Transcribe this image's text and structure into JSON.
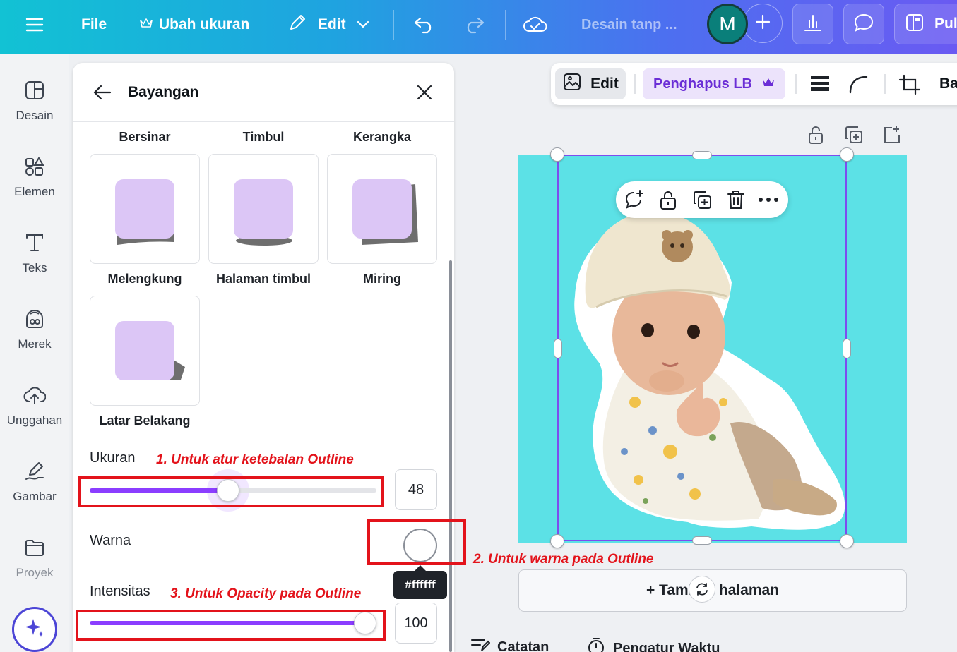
{
  "topbar": {
    "file_label": "File",
    "resize_label": "Ubah ukuran",
    "edit_label": "Edit",
    "doc_title": "Desain tanp ...",
    "avatar_initial": "M",
    "publish_label": "Pul"
  },
  "rail": {
    "items": [
      {
        "label": "Desain",
        "icon": "layout-icon"
      },
      {
        "label": "Elemen",
        "icon": "shapes-icon"
      },
      {
        "label": "Teks",
        "icon": "text-icon"
      },
      {
        "label": "Merek",
        "icon": "brand-icon"
      },
      {
        "label": "Unggahan",
        "icon": "upload-cloud-icon"
      },
      {
        "label": "Gambar",
        "icon": "draw-icon"
      },
      {
        "label": "Proyek",
        "icon": "folder-icon"
      }
    ]
  },
  "panel": {
    "title": "Bayangan",
    "top_labels": [
      "Bersinar",
      "Timbul",
      "Kerangka"
    ],
    "effects": [
      "Melengkung",
      "Halaman timbul",
      "Miring",
      "Latar Belakang"
    ],
    "size_label": "Ukuran",
    "size_value": "48",
    "size_fraction": 0.48,
    "color_label": "Warna",
    "color_hex": "#ffffff",
    "intensity_label": "Intensitas",
    "intensity_value": "100",
    "intensity_fraction": 1.0
  },
  "annotations": {
    "a1": "1. Untuk atur ketebalan Outline",
    "a2": "2. Untuk warna pada Outline",
    "a3": "3. Untuk Opacity pada Outline"
  },
  "context_toolbar": {
    "edit_label": "Edit",
    "bg_remover_label": "Penghapus LB",
    "truncated_label": "Ba"
  },
  "canvas": {
    "background_color": "#5ce1e6",
    "add_page_label": "+ Tambah halaman"
  },
  "bottom": {
    "notes_label": "Catatan",
    "timer_label": "Pengatur Waktu"
  },
  "colors": {
    "accent": "#8b3dff",
    "annotation_red": "#e3131b"
  }
}
